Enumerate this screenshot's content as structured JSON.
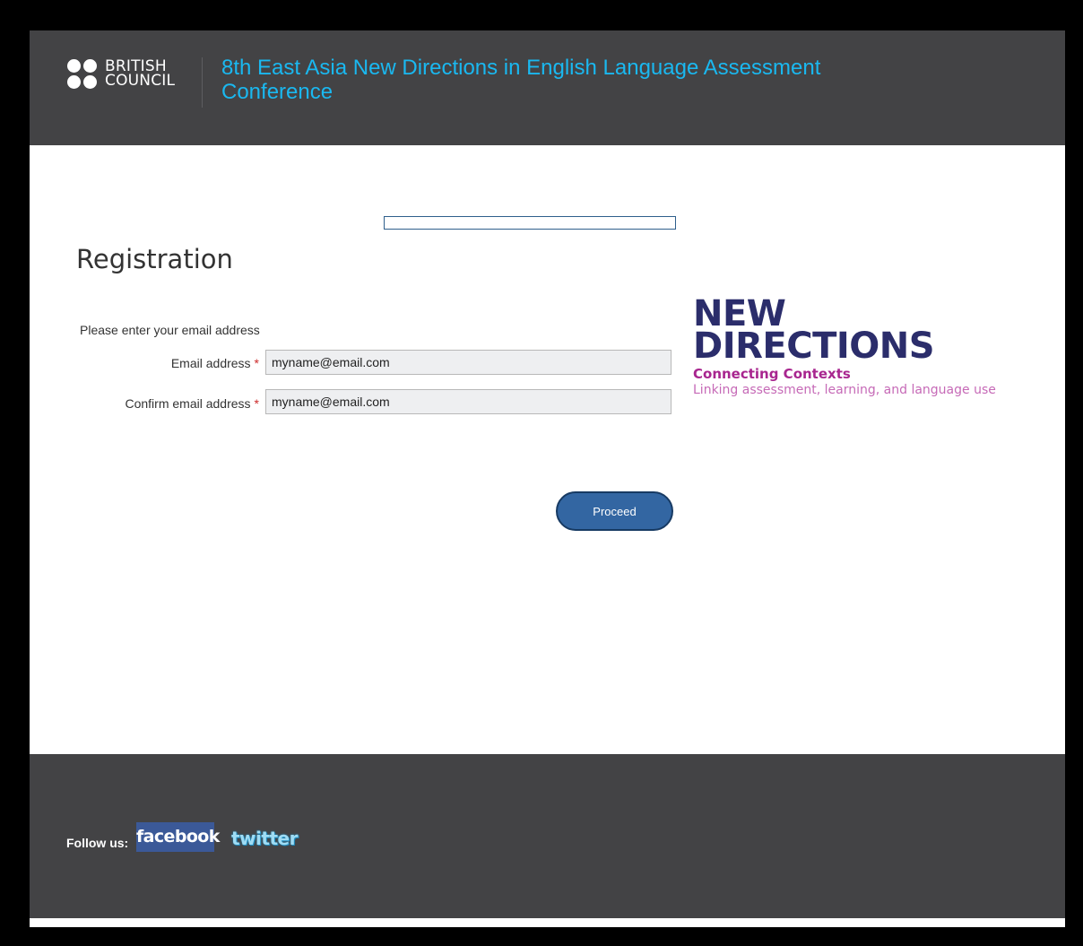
{
  "header": {
    "brand_logo": [
      "BRITISH",
      "COUNCIL"
    ],
    "conference_title": "8th East Asia New Directions in English Language Assessment Conference"
  },
  "main": {
    "progress_label": "",
    "heading": "Registration",
    "intro": "Please enter your email address",
    "fields": [
      {
        "label": "Email address",
        "required_marker": "*",
        "value": "myname@email.com"
      },
      {
        "label": "Confirm email address",
        "required_marker": "*",
        "value": "myname@email.com"
      }
    ],
    "proceed_label": "Proceed"
  },
  "event_logo": {
    "line1": "NEW",
    "line2": "DIRECTIONS",
    "subtitle": "Connecting Contexts",
    "tagline": "Linking assessment, learning, and language use"
  },
  "footer": {
    "follow_label": "Follow us:",
    "social": [
      {
        "label": "facebook",
        "icon": "facebook-icon"
      },
      {
        "label": "twitter",
        "icon": "twitter-icon"
      }
    ]
  },
  "colors": {
    "header_bg": "#434345",
    "title_blue": "#1ab8f0",
    "button_blue": "#3366a2",
    "logo_navy": "#2b2d6b",
    "logo_magenta": "#a8268f"
  }
}
